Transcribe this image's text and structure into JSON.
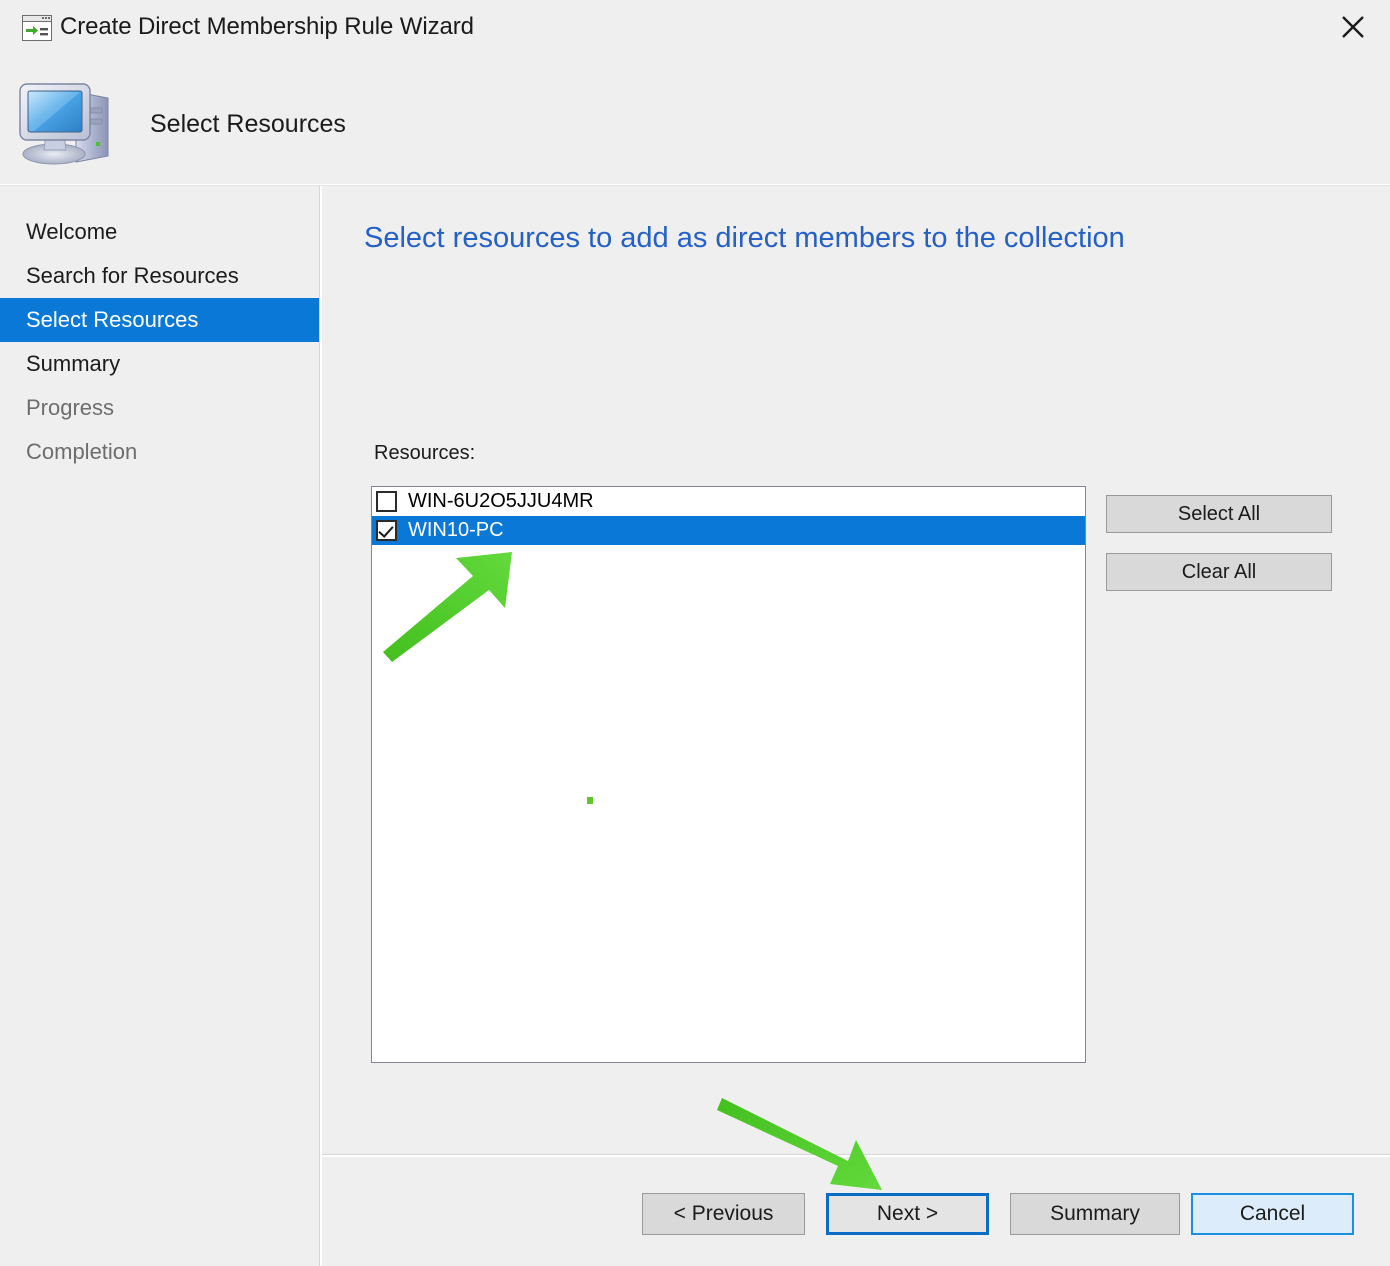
{
  "window": {
    "title": "Create Direct Membership Rule Wizard",
    "icon": "wizard-window-icon",
    "close_label": "✕"
  },
  "header": {
    "title": "Select Resources",
    "icon": "computer-icon"
  },
  "sidebar": {
    "items": [
      {
        "label": "Welcome",
        "state": "normal"
      },
      {
        "label": "Search for Resources",
        "state": "normal"
      },
      {
        "label": "Select Resources",
        "state": "active"
      },
      {
        "label": "Summary",
        "state": "normal"
      },
      {
        "label": "Progress",
        "state": "dim"
      },
      {
        "label": "Completion",
        "state": "dim"
      }
    ]
  },
  "main": {
    "heading": "Select resources to add as direct members to the collection",
    "resources_label": "Resources:",
    "resources": [
      {
        "name": "WIN-6U2O5JJU4MR",
        "checked": false,
        "selected": false
      },
      {
        "name": "WIN10-PC",
        "checked": true,
        "selected": true
      }
    ],
    "side_buttons": {
      "select_all": "Select All",
      "clear_all": "Clear All"
    }
  },
  "footer": {
    "previous": "< Previous",
    "next": "Next >",
    "summary": "Summary",
    "cancel": "Cancel"
  },
  "annotations": {
    "arrow_1": "green-arrow-pointing-to-selected-resource",
    "arrow_2": "green-arrow-pointing-to-next-button"
  },
  "colors": {
    "selection_blue": "#0a78d6",
    "heading_blue": "#2560c4",
    "focus_border_blue": "#0a6cc4",
    "cancel_hover_blue": "#dcecfa",
    "annotation_green": "#4ec22a",
    "window_bg": "#efeff0"
  }
}
